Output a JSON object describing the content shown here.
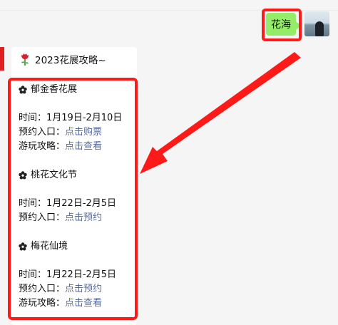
{
  "sent_message": {
    "text": "花海"
  },
  "card": {
    "header": {
      "emoji_icon": "rose-icon",
      "title": "2023花展攻略~"
    },
    "sections": [
      {
        "icon": "flower-icon",
        "name": "郁金香花展",
        "time_label": "时间：",
        "time_value": "1月19日-2月10日",
        "booking_label": "预约入口：",
        "booking_link": "点击购票",
        "guide_label": "游玩攻略：",
        "guide_link": "点击查看"
      },
      {
        "icon": "flower-icon",
        "name": "桃花文化节",
        "time_label": "时间：",
        "time_value": "1月22日-2月5日",
        "booking_label": "预约入口：",
        "booking_link": "点击预约"
      },
      {
        "icon": "flower-icon",
        "name": "梅花仙境",
        "time_label": "时间：",
        "time_value": "1月22日-2月5日",
        "booking_label": "预约入口：",
        "booking_link": "点击预约",
        "guide_label": "游玩攻略：",
        "guide_link": "点击查看"
      }
    ]
  },
  "colors": {
    "sent_bubble": "#95ec69",
    "highlight": "#ff1a1a",
    "link": "#576b95"
  }
}
